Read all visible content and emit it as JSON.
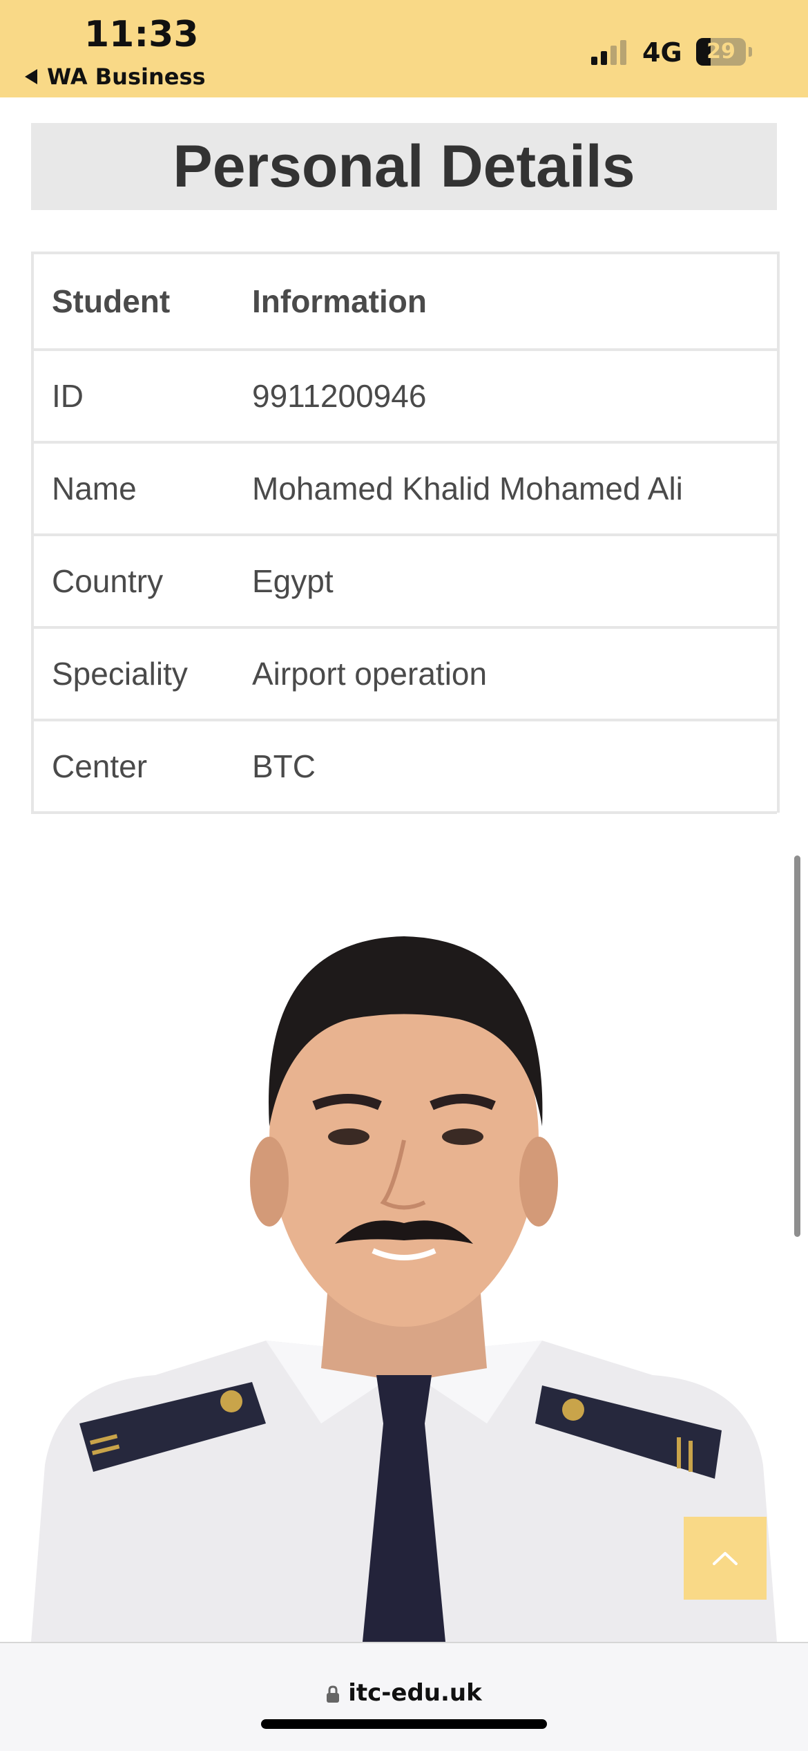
{
  "status_bar": {
    "time": "11:33",
    "back_app": "WA Business",
    "network": "4G",
    "battery": "29",
    "battery_level": 0.29,
    "signal_bars_active": 2,
    "signal_bars_total": 4
  },
  "page": {
    "heading": "Personal Details"
  },
  "table": {
    "headers": [
      "Student",
      "Information"
    ],
    "rows": [
      {
        "label": "ID",
        "value": "9911200946"
      },
      {
        "label": "Name",
        "value": "Mohamed Khalid Mohamed Ali"
      },
      {
        "label": "Country",
        "value": "Egypt"
      },
      {
        "label": "Speciality",
        "value": "Airport operation"
      },
      {
        "label": "Center",
        "value": "BTC"
      }
    ]
  },
  "browser": {
    "url": "itc-edu.uk"
  },
  "colors": {
    "accent": "#f9d987",
    "heading_bg": "#e8e8e8",
    "table_border": "#e6e6e6"
  },
  "icons": [
    "back-triangle-icon",
    "signal-icon",
    "battery-icon",
    "chevron-up-icon",
    "lock-icon"
  ]
}
